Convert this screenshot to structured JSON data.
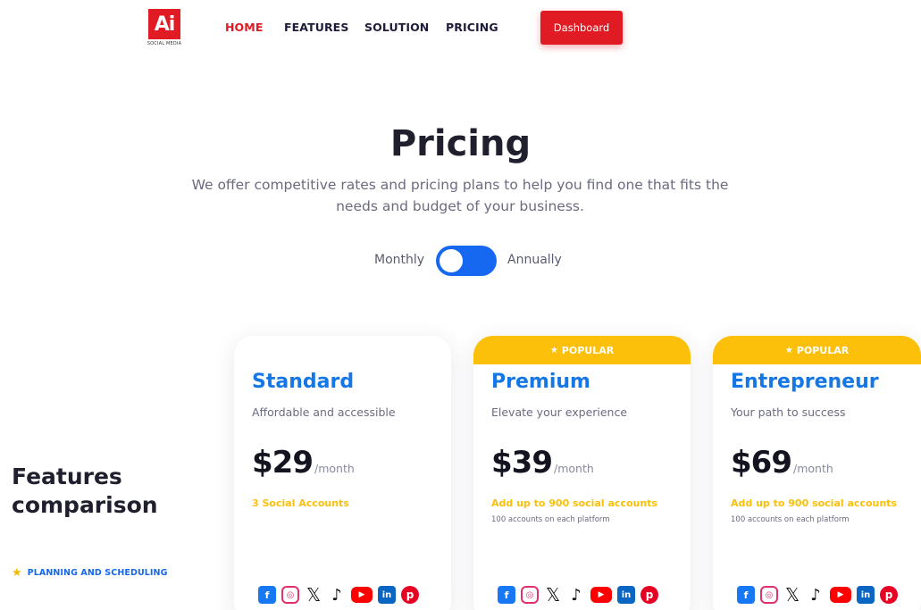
{
  "brand": {
    "logo_text": "Ai",
    "logo_sub": "SOCIAL MEDIA"
  },
  "nav": {
    "links": [
      "HOME",
      "FEATURES",
      "SOLUTION",
      "PRICING"
    ],
    "active": "HOME",
    "dashboard_label": "Dashboard"
  },
  "hero": {
    "title": "Pricing",
    "subtitle": "We offer competitive rates and pricing plans to help you find one that fits the needs and budget of your business."
  },
  "billing_toggle": {
    "left_label": "Monthly",
    "right_label": "Annually",
    "selected": "Monthly"
  },
  "features": {
    "title_line1": "Features",
    "title_line2": "comparison",
    "category": "PLANNING AND SCHEDULING"
  },
  "colors": {
    "brand_red": "#e01b24",
    "accent_blue": "#1668f0",
    "plan_blue": "#1577e6",
    "popular_yellow": "#fcbf0a"
  },
  "plans": [
    {
      "name": "Standard",
      "tagline": "Affordable and accessible",
      "price": "$29",
      "period": "/month",
      "accounts": "3 Social Accounts",
      "note": "",
      "badge": ""
    },
    {
      "name": "Premium",
      "tagline": "Elevate your experience",
      "price": "$39",
      "period": "/month",
      "accounts": "Add up to 900 social accounts",
      "note": "100 accounts on each platform",
      "badge": "POPULAR"
    },
    {
      "name": "Entrepreneur",
      "tagline": "Your path to success",
      "price": "$69",
      "period": "/month",
      "accounts": "Add up to 900 social accounts",
      "note": "100 accounts on each platform",
      "badge": "POPULAR"
    }
  ],
  "social_icons": [
    "facebook-icon",
    "instagram-icon",
    "x-icon",
    "tiktok-icon",
    "youtube-icon",
    "linkedin-icon",
    "pinterest-icon"
  ]
}
